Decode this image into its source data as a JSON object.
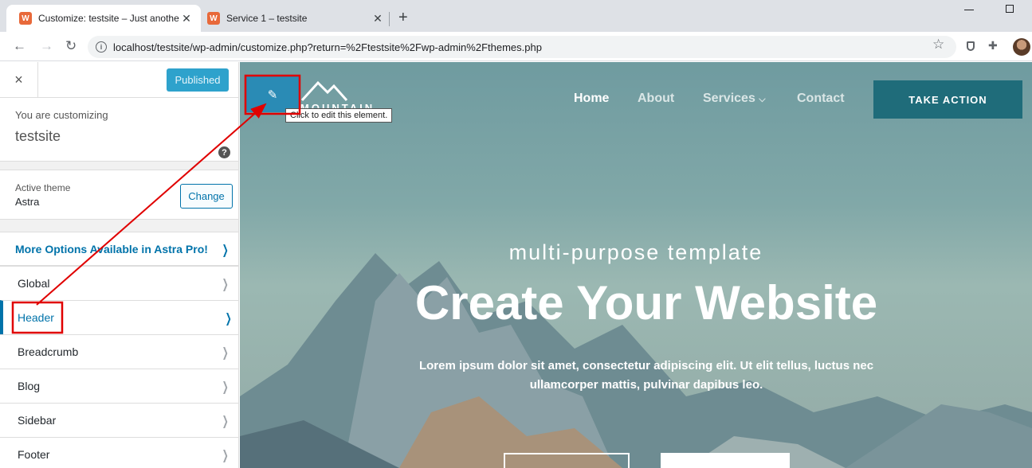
{
  "browser": {
    "tabs": [
      {
        "title": "Customize: testsite – Just anothe",
        "active": true
      },
      {
        "title": "Service 1 – testsite",
        "active": false
      }
    ],
    "new_tab_label": "+",
    "url": "localhost/testsite/wp-admin/customize.php?return=%2Ftestsite%2Fwp-admin%2Fthemes.php",
    "icons": [
      "back-arrow-icon",
      "forward-arrow-icon",
      "reload-icon",
      "info-icon",
      "star-icon",
      "shield-icon",
      "puzzle-icon"
    ]
  },
  "sidebar": {
    "close_label": "×",
    "publish_label": "Published",
    "customizing_label": "You are customizing",
    "site_name": "testsite",
    "help_label": "?",
    "active_theme_label": "Active theme",
    "theme_name": "Astra",
    "change_label": "Change",
    "promo_label": "More Options Available in Astra Pro!",
    "items": [
      {
        "label": "Global"
      },
      {
        "label": "Header"
      },
      {
        "label": "Breadcrumb"
      },
      {
        "label": "Blog"
      },
      {
        "label": "Sidebar"
      },
      {
        "label": "Footer"
      }
    ]
  },
  "preview": {
    "logo_text": "MOUNTAIN",
    "tooltip": "Click to edit this element.",
    "nav": [
      "Home",
      "About",
      "Services",
      "Contact"
    ],
    "services_chevron": "⌵",
    "cta_label": "TAKE ACTION",
    "hero_subtitle": "multi-purpose template",
    "hero_title": "Create Your Website",
    "hero_description": "Lorem ipsum dolor sit amet, consectetur adipiscing elit. Ut elit tellus, luctus nec ullamcorper mattis, pulvinar dapibus leo."
  },
  "colors": {
    "accent": "#0073aa",
    "publish_button": "#2ea2cc",
    "cta_button": "#1f6c7a",
    "annotation": "#e00000"
  }
}
